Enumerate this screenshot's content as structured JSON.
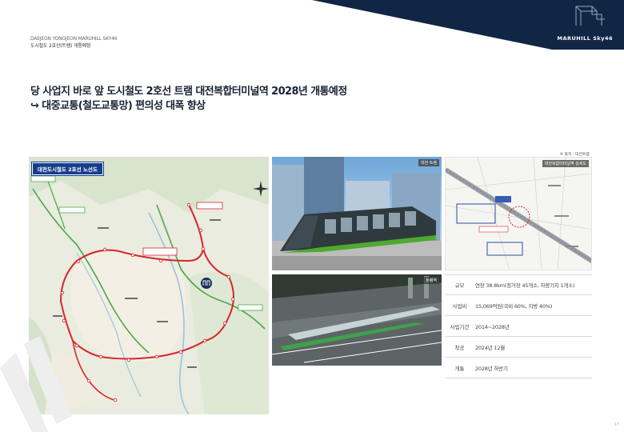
{
  "header": {
    "project_name": "DAEJEON YONGJEON MARUHILL SKY46",
    "section": "도시철도 2호선(트램) 개통예정",
    "brand": "MARUHILL Sky46"
  },
  "headline": {
    "line1": "당 사업지 바로 앞 도시철도 2호선 트램 대전복합터미널역 2028년 개통예정",
    "line2": "대중교통(철도교통망) 편의성 대폭 향상",
    "arrow": "↪"
  },
  "source_note": "※ 출처 : 대전트램",
  "map": {
    "title": "대전도시철도 2호선 노선도"
  },
  "photos": {
    "tram_label": "대전 트램",
    "station_label": "트램역",
    "plan_label": "대전복합터미널역 상세도"
  },
  "info": [
    {
      "key": "규모",
      "value": "연장 38.8km(정거장 45개소, 차량기지 1개소)"
    },
    {
      "key": "사업비",
      "value": "15,069억원(국비 60%, 지방 40%)"
    },
    {
      "key": "사업기간",
      "value": "2014~2028년"
    },
    {
      "key": "착공",
      "value": "2024년 12월"
    },
    {
      "key": "개통",
      "value": "2028년 하반기"
    }
  ],
  "colors": {
    "navy": "#0f2745",
    "line_red": "#d7262d",
    "line_green": "#4aa84a"
  },
  "page_number": "17"
}
